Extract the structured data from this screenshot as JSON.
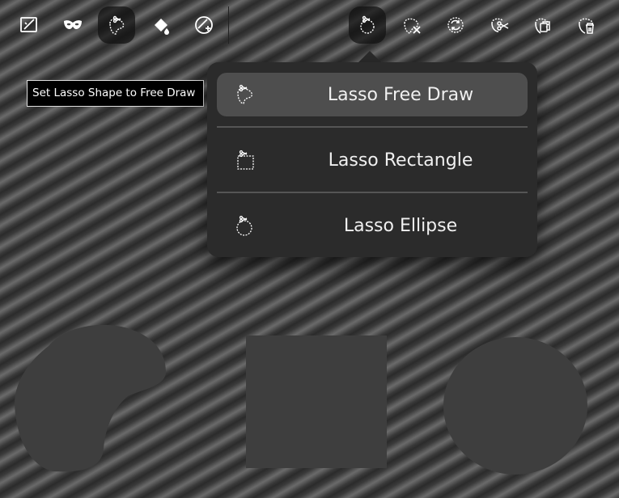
{
  "toolbar": {
    "left_tools": [
      {
        "icon": "crop-picture-icon"
      },
      {
        "icon": "mask-icon"
      },
      {
        "icon": "lasso-free-draw-icon",
        "active": true
      },
      {
        "icon": "paint-bucket-icon"
      },
      {
        "icon": "adjust-add-icon"
      }
    ],
    "right_tools": [
      {
        "icon": "lasso-ellipse-icon",
        "active": true
      },
      {
        "icon": "lasso-clear-icon"
      },
      {
        "icon": "lasso-invert-icon"
      },
      {
        "icon": "lasso-cut-icon"
      },
      {
        "icon": "lasso-copy-icon"
      },
      {
        "icon": "lasso-delete-icon"
      }
    ]
  },
  "tooltip": {
    "text": "Set Lasso Shape to Free Draw"
  },
  "dropdown": {
    "items": [
      {
        "label": "Lasso Free Draw",
        "icon": "lasso-free-draw-icon",
        "selected": true
      },
      {
        "label": "Lasso Rectangle",
        "icon": "lasso-rectangle-icon",
        "selected": false
      },
      {
        "label": "Lasso Ellipse",
        "icon": "lasso-ellipse-icon",
        "selected": false
      }
    ]
  },
  "canvas": {
    "shape_color": "#3e3e3e",
    "shapes": [
      "free-form-shape",
      "square-shape",
      "circle-shape"
    ]
  },
  "colors": {
    "panel": "#2b2b2b",
    "selected_item": "#4e4e4e",
    "icon": "#ffffff"
  }
}
